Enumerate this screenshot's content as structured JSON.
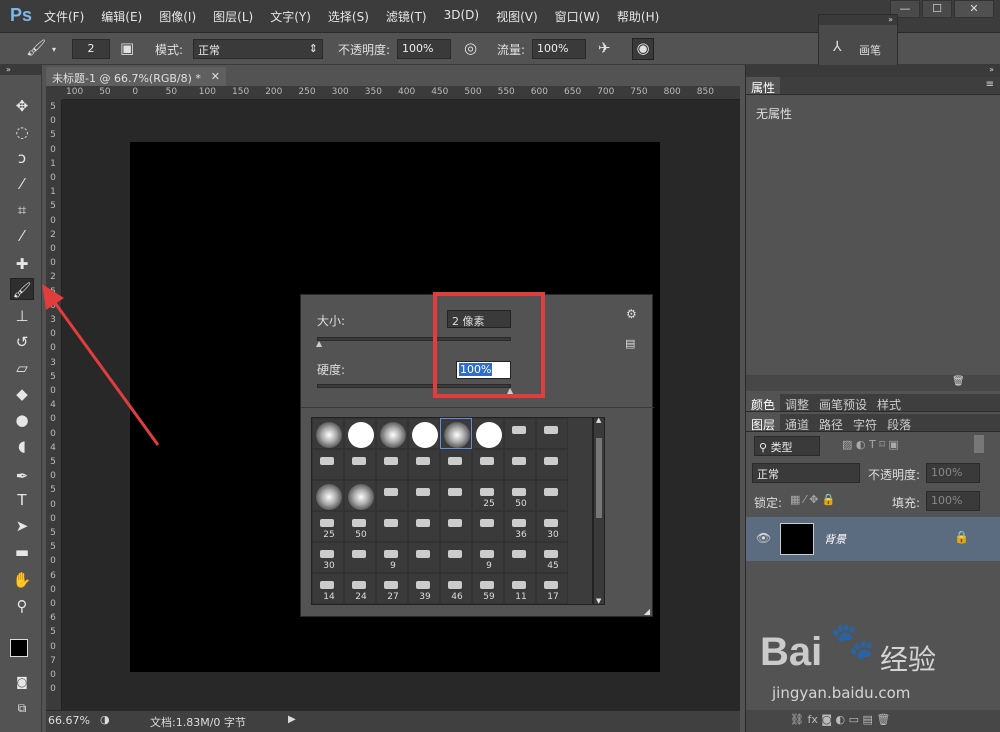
{
  "app": {
    "logo": "Ps"
  },
  "menu": [
    "文件(F)",
    "编辑(E)",
    "图像(I)",
    "图层(L)",
    "文字(Y)",
    "选择(S)",
    "滤镜(T)",
    "3D(D)",
    "视图(V)",
    "窗口(W)",
    "帮助(H)"
  ],
  "window_buttons": [
    "—",
    "☐",
    "✕"
  ],
  "options": {
    "brush_size": "2",
    "mode_label": "模式:",
    "mode_value": "正常",
    "opacity_label": "不透明度:",
    "opacity_value": "100%",
    "flow_label": "流量:",
    "flow_value": "100%"
  },
  "brush_panel_mini": {
    "label": "画笔"
  },
  "document": {
    "tab_title": "未标题-1 @ 66.7%(RGB/8) *",
    "close": "✕"
  },
  "ruler_h": [
    "100",
    "50",
    "0",
    "50",
    "100",
    "150",
    "200",
    "250",
    "300",
    "350",
    "400",
    "450",
    "500",
    "550",
    "600",
    "650",
    "700",
    "750",
    "800",
    "850"
  ],
  "ruler_v": [
    "5",
    "0",
    "5",
    "0",
    "1",
    "0",
    "1",
    "5",
    "0",
    "2",
    "0",
    "0",
    "2",
    "5",
    "0",
    "3",
    "0",
    "0",
    "3",
    "5",
    "0",
    "4",
    "0",
    "0",
    "4",
    "5",
    "0",
    "5",
    "0",
    "0",
    "5",
    "5",
    "0",
    "6",
    "0",
    "0",
    "6",
    "5",
    "0",
    "7",
    "0",
    "0"
  ],
  "status": {
    "zoom": "66.67%",
    "doc_info": "文档:1.83M/0 字节"
  },
  "brush_picker": {
    "size_label": "大小:",
    "size_value": "2 像素",
    "hardness_label": "硬度:",
    "hardness_value": "100%",
    "presets": [
      [
        "",
        "",
        "",
        "",
        "",
        "",
        "",
        ""
      ],
      [
        "",
        "",
        "",
        "",
        "",
        "",
        "",
        ""
      ],
      [
        "",
        "",
        "",
        "",
        "",
        "25",
        "50",
        ""
      ],
      [
        "25",
        "50",
        "",
        "",
        "",
        "",
        "36",
        "30"
      ],
      [
        "30",
        "",
        "9",
        "",
        "",
        "9",
        "",
        "45"
      ],
      [
        "14",
        "24",
        "27",
        "39",
        "46",
        "59",
        "11",
        "17"
      ]
    ]
  },
  "properties": {
    "tab": "属性",
    "content": "无属性"
  },
  "color_tabs": [
    "颜色",
    "调整",
    "画笔预设",
    "样式"
  ],
  "layer_tabs": [
    "图层",
    "通道",
    "路径",
    "字符",
    "段落"
  ],
  "layers": {
    "filter_label": "类型",
    "blend_mode": "正常",
    "opacity_label": "不透明度:",
    "opacity_value": "100%",
    "lock_label": "锁定:",
    "fill_label": "填充:",
    "fill_value": "100%",
    "layer_name": "背景"
  },
  "watermark": {
    "brand": "Bai",
    "brand2": "经验",
    "url": "jingyan.baidu.com"
  },
  "colors": {
    "highlight": "#e23d3d",
    "arrow": "#e23d3d",
    "selected_layer": "#5b6b80"
  }
}
